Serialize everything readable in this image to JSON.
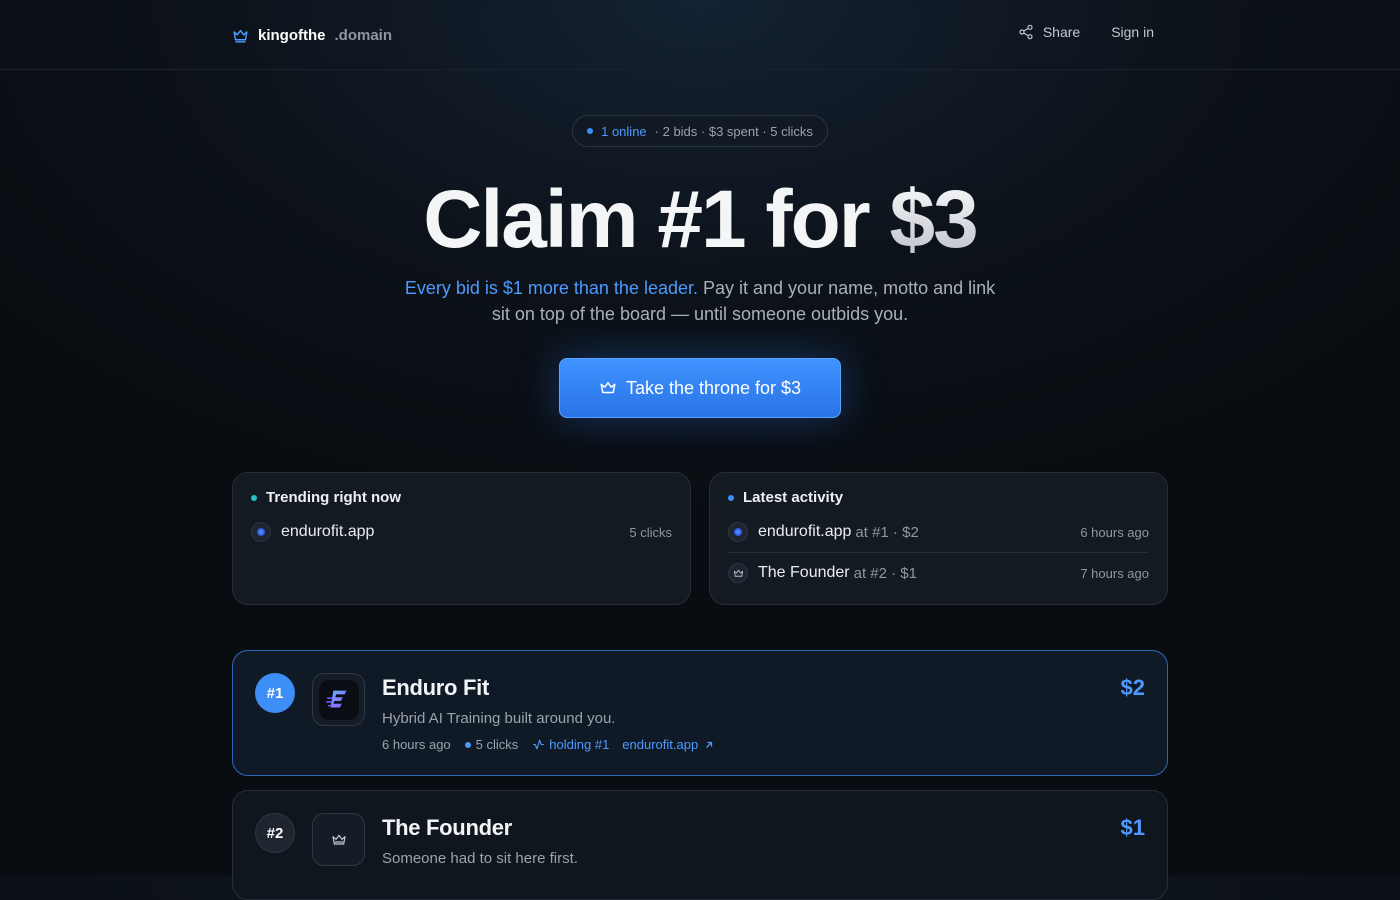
{
  "header": {
    "brand_main": "kingofthe",
    "brand_tld": ".domain",
    "share_label": "Share",
    "signin_label": "Sign in"
  },
  "stats": {
    "online": "1 online",
    "rest": "· 2 bids · $3 spent · 5 clicks"
  },
  "hero": {
    "title_main": "Claim #1 for ",
    "title_price": "$3",
    "subtitle_highlight": "Every bid is $1 more than the leader.",
    "subtitle_rest": " Pay it and your name, motto and link sit on top of the board — until someone outbids you.",
    "cta_label": "Take the throne for $3"
  },
  "trending": {
    "title": "Trending right now",
    "items": [
      {
        "name": "endurofit.app",
        "clicks": "5 clicks",
        "icon": "endurofit-avatar-icon"
      }
    ]
  },
  "activity": {
    "title": "Latest activity",
    "items": [
      {
        "name": "endurofit.app",
        "detail": "at #1 · $2",
        "time": "6 hours ago",
        "icon": "endurofit-avatar-icon"
      },
      {
        "name": "The Founder",
        "detail": "at #2 · $1",
        "time": "7 hours ago",
        "icon": "crown-icon"
      }
    ]
  },
  "leaderboard": [
    {
      "rank": "#1",
      "title": "Enduro Fit",
      "motto": "Hybrid AI Training built around you.",
      "time": "6 hours ago",
      "clicks": "5 clicks",
      "status": "holding #1",
      "link": "endurofit.app",
      "price": "$2"
    },
    {
      "rank": "#2",
      "title": "The Founder",
      "motto": "Someone had to sit here first.",
      "price": "$1"
    }
  ],
  "colors": {
    "accent": "#3e8ef7",
    "accent_text": "#4d9aff",
    "trending_dot": "#22c3c3",
    "background": "#0c1219"
  }
}
